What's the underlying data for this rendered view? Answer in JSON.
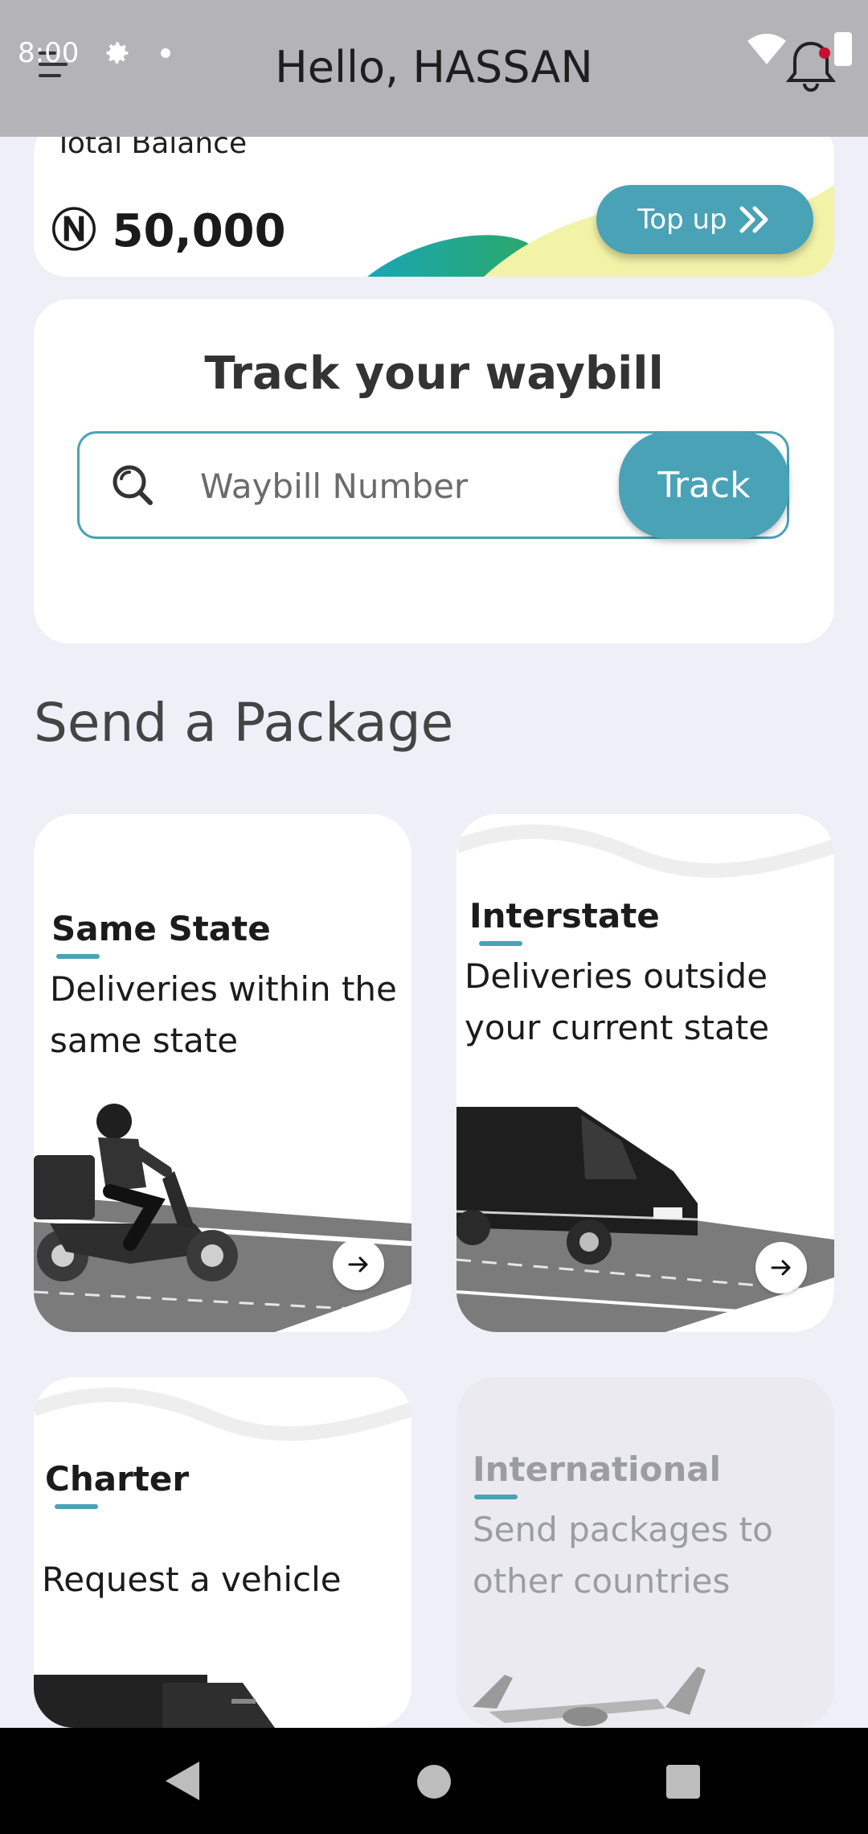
{
  "status_bar": {
    "time": "8:00"
  },
  "header": {
    "greeting": "Hello, HASSAN",
    "icons": [
      "menu-icon",
      "gear-icon",
      "wifi-icon",
      "battery-icon",
      "bell-icon"
    ]
  },
  "balance": {
    "label": "Total Balance",
    "amount": "Ⓝ 50,000",
    "topup_label": "Top up"
  },
  "track": {
    "title": "Track your waybill",
    "placeholder": "Waybill Number",
    "button_label": "Track"
  },
  "send_section": {
    "title": "Send a Package",
    "cards": [
      {
        "title": "Same State",
        "description": "Deliveries within the same state",
        "enabled": true
      },
      {
        "title": "Interstate",
        "description": "Deliveries outside  your current state",
        "enabled": true
      },
      {
        "title": "Charter",
        "description": "Request a vehicle",
        "enabled": true
      },
      {
        "title": "International",
        "description": "Send packages to other countries",
        "enabled": false
      }
    ]
  },
  "colors": {
    "accent": "#4aa2b6",
    "background": "#eeeff7",
    "appbar": "#b3b3b8"
  }
}
